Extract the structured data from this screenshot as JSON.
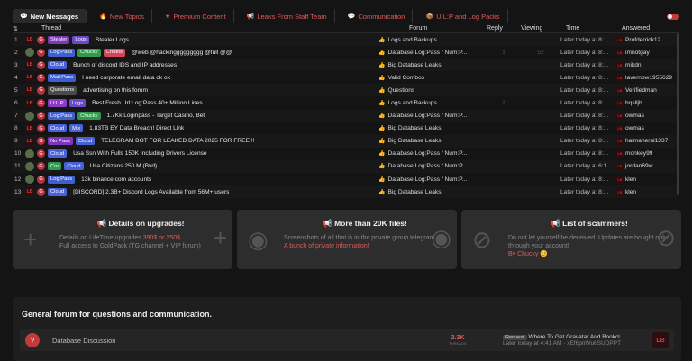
{
  "tabs": [
    {
      "label": "New Messages",
      "icon": "chat-icon"
    },
    {
      "label": "New Topics",
      "icon": "flame-icon"
    },
    {
      "label": "Premium Content",
      "icon": "star-icon"
    },
    {
      "label": "Leaks From Staff Team",
      "icon": "megaphone-icon"
    },
    {
      "label": "Communication",
      "icon": "chat-bubble-icon"
    },
    {
      "label": "U:L:P and Log Packs",
      "icon": "package-icon"
    }
  ],
  "columns": {
    "thread": "Thread",
    "forum": "Forum",
    "reply": "Reply",
    "viewing": "Viewing",
    "time": "Time",
    "answered": "Answered"
  },
  "rows": [
    {
      "num": "1",
      "avatar": "LB",
      "badges": [
        "Stealer",
        "Logs"
      ],
      "title": "Stealer Logs",
      "forum": "Logs and Backups",
      "reply": "",
      "view": "",
      "time": "Later today at 8:...",
      "answered": "Profderrick12"
    },
    {
      "num": "2",
      "avatar": "",
      "badges": [
        "Log:Pass",
        "Chucky",
        "Credits"
      ],
      "title": "@web @hackinggggggggg @full @@",
      "forum": "Database Log:Pass / Num:P...",
      "reply": "1",
      "view": "52",
      "time": "Later today at 8:...",
      "answered": "imnotgay"
    },
    {
      "num": "3",
      "avatar": "LB",
      "badges": [
        "Cloud"
      ],
      "title": "Bunch of discord IDS and IP addresses",
      "forum": "Big Database Leaks",
      "reply": "",
      "view": "",
      "time": "Later today at 8:...",
      "answered": "mikdn"
    },
    {
      "num": "4",
      "avatar": "LB",
      "badges": [
        "Mail:Pass"
      ],
      "title": "I need corporate email data ok ok",
      "forum": "Valid Combos",
      "reply": "",
      "view": "",
      "time": "Later today at 8:...",
      "answered": "lavernbw1955629"
    },
    {
      "num": "5",
      "avatar": "LB",
      "badges": [
        "Questions"
      ],
      "title": "advertising on this forum",
      "forum": "Questions",
      "reply": "",
      "view": "",
      "time": "Later today at 8:...",
      "answered": "Verifiedman"
    },
    {
      "num": "6",
      "avatar": "LB",
      "badges": [
        "U:L:P",
        "Logs"
      ],
      "title": "Best Fresh Url:Log:Pass 40+ Million Lines",
      "forum": "Logs and Backups",
      "reply": "2",
      "view": "",
      "time": "Later today at 8:...",
      "answered": "hqslljh"
    },
    {
      "num": "7",
      "avatar": "",
      "badges": [
        "Log:Pass",
        "Chucky"
      ],
      "title": "1.7Kk Loginpass - Target Casino, Bet",
      "forum": "Database Log:Pass / Num:P...",
      "reply": "",
      "view": "",
      "time": "Later today at 8:...",
      "answered": "owmas"
    },
    {
      "num": "8",
      "avatar": "LB",
      "badges": [
        "Cloud",
        "Mix"
      ],
      "title": "1.83TB EY Data Breach! Direct Link",
      "forum": "Big Database Leaks",
      "reply": "",
      "view": "",
      "time": "Later today at 8:...",
      "answered": "owmas"
    },
    {
      "num": "9",
      "avatar": "LB",
      "badges": [
        "No Pass",
        "Cloud"
      ],
      "title": "TELEGRAM BOT FOR LEAKED DATA 2025 FOR FREE !!",
      "forum": "Big Database Leaks",
      "reply": "",
      "view": "",
      "time": "Later today at 8:...",
      "answered": "halmaheral1337"
    },
    {
      "num": "10",
      "avatar": "",
      "badges": [
        "Cloud"
      ],
      "title": "Usa Ssn With Fulls 150K Including Drivers License",
      "forum": "Database Log:Pass / Num:P...",
      "reply": "",
      "view": "",
      "time": "Later today at 8:...",
      "answered": "monkey99"
    },
    {
      "num": "11",
      "avatar": "",
      "badges": [
        "Cor",
        "Cloud"
      ],
      "title": "Usa Citizens 250 M (Bvd)",
      "forum": "Database Log:Pass / Num:P...",
      "reply": "",
      "view": "",
      "time": "Later today at 6:1...",
      "answered": "jordan69w"
    },
    {
      "num": "12",
      "avatar": "",
      "badges": [
        "Log:Pass"
      ],
      "title": "13k binance.com accounts",
      "forum": "Database Log:Pass / Num:P...",
      "reply": "",
      "view": "",
      "time": "Later today at 8:...",
      "answered": "klen"
    },
    {
      "num": "13",
      "avatar": "LB",
      "badges": [
        "Cloud"
      ],
      "title": "[DISCORD] 2.3B+ Discord Logs Available from 56M+ users",
      "forum": "Big Database Leaks",
      "reply": "",
      "view": "",
      "time": "Later today at 8:...",
      "answered": "klen"
    }
  ],
  "cards": [
    {
      "title": "Details on upgrades!",
      "line1_a": "Details on LifeTime upgrades ",
      "line1_hl": "390$ or 250$",
      "line2": "Full access to GoldPack (TG channel + VIP forum)"
    },
    {
      "title": "More than 20K files!",
      "line1": "Screenshots of all that is in the private group telegram.",
      "hl": "A bunch of private information!"
    },
    {
      "title": "List of scammers!",
      "line1": "Do not let yourself be deceived. Updates are bought only through your account!",
      "hl": "By Chucky"
    }
  ],
  "section": {
    "heading": "General forum for questions and communication.",
    "row_name": "Database Discussion",
    "threads_count": "2.3K",
    "threads_label": "THREADS",
    "request_tag": "Request",
    "last_title": "Where To Get Gravatar And Bookcl...",
    "last_time": "Later today at 4:41 AM",
    "last_user": "xEf6pnWu6SUDPPT"
  }
}
